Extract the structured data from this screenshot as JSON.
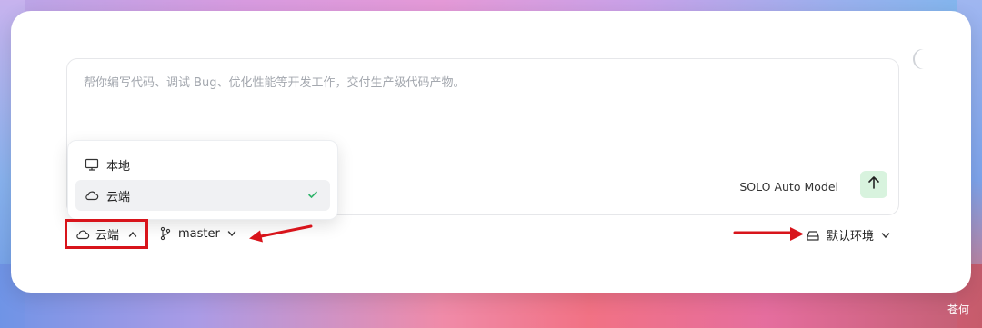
{
  "composer": {
    "placeholder": "帮你编写代码、调试 Bug、优化性能等开发工作，交付生产级代码产物。",
    "model_label": "SOLO Auto Model",
    "send_icon": "arrow-up-icon"
  },
  "location_menu": {
    "items": [
      {
        "label": "本地",
        "icon": "monitor-icon",
        "selected": false
      },
      {
        "label": "云端",
        "icon": "cloud-icon",
        "selected": true
      }
    ]
  },
  "toolbar": {
    "environment_label": "云端",
    "branch_label": "master",
    "runtime_label": "默认环境"
  },
  "annotations": {
    "highlight_color": "#d8141b"
  },
  "watermark": "苍何",
  "colors": {
    "send_button_bg": "#d8f3de",
    "check_color": "#2fb36a"
  }
}
